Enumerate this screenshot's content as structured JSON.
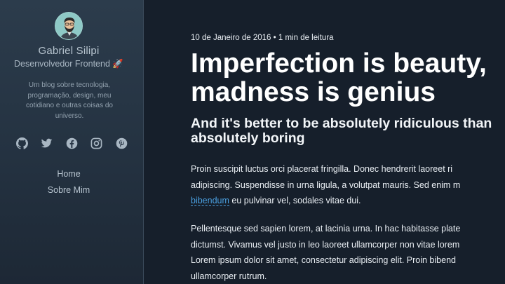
{
  "sidebar": {
    "author_name": "Gabriel Silipi",
    "author_role": "Desenvolvedor Frontend 🚀",
    "bio": "Um blog sobre tecnologia, programação, design, meu cotidiano e outras coisas do universo.",
    "socials": [
      "github-icon",
      "twitter-icon",
      "facebook-icon",
      "instagram-icon",
      "pinterest-icon"
    ],
    "nav": [
      {
        "label": "Home"
      },
      {
        "label": "Sobre Mim"
      }
    ]
  },
  "post": {
    "meta": "10 de Janeiro de 2016 • 1 min de leitura",
    "title_line1": "Imperfection is beauty,",
    "title_line2": "madness is genius",
    "subtitle_line1": "And it's better to be absolutely ridiculous than",
    "subtitle_line2": "absolutely boring",
    "p1_line1": "Proin suscipit luctus orci placerat fringilla. Donec hendrerit laoreet ri",
    "p1_line2": "adipiscing. Suspendisse in urna ligula, a volutpat mauris. Sed enim m",
    "p1_link": "bibendum",
    "p1_line3_rest": " eu pulvinar vel, sodales vitae dui.",
    "p2_line1": "Pellentesque sed sapien lorem, at lacinia urna. In hac habitasse plate",
    "p2_line2": "dictumst. Vivamus vel justo in leo laoreet ullamcorper non vitae lorem",
    "p2_line3": "Lorem ipsum dolor sit amet, consectetur adipiscing elit. Proin bibend",
    "p2_line4": "ullamcorper rutrum."
  },
  "colors": {
    "background": "#161f2b",
    "sidebar": "#2c3c4c",
    "link": "#4a9fe0"
  }
}
